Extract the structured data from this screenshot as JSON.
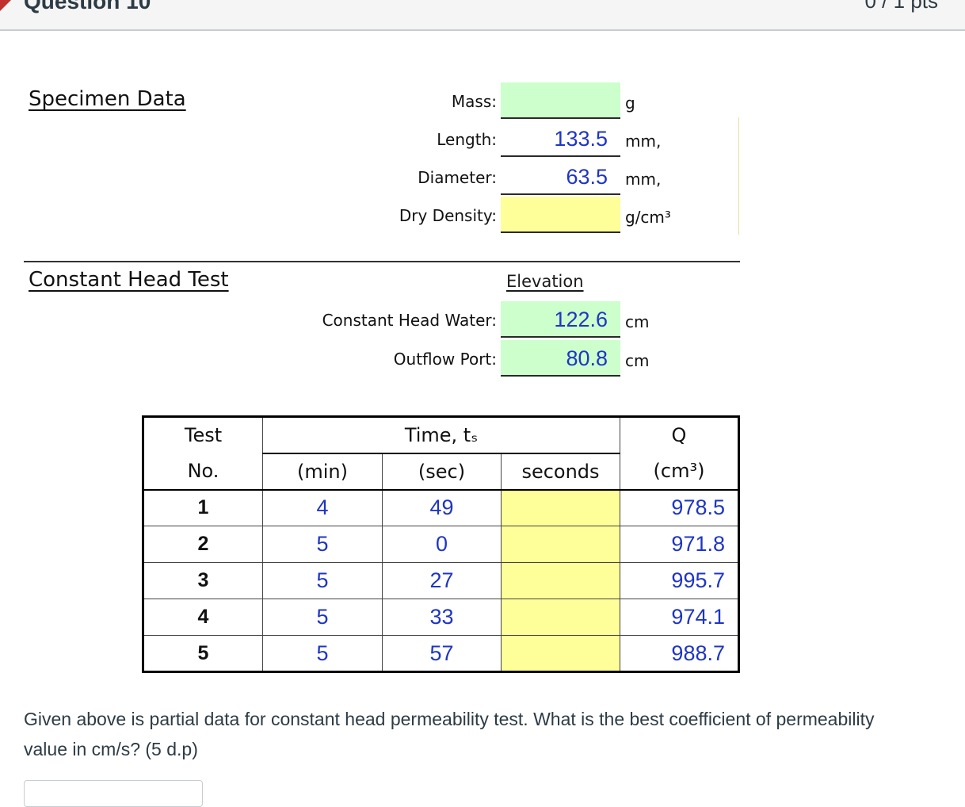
{
  "question": {
    "title": "Question 10",
    "points": "0 / 1 pts",
    "prompt": "Given above is partial data for constant head permeability test. What is the best coefficient of permeability value in cm/s? (5 d.p)",
    "answer_value": ""
  },
  "specimen": {
    "title": "Specimen Data",
    "rows": [
      {
        "label": "Mass:",
        "value": "",
        "unit": "g"
      },
      {
        "label": "Length:",
        "value": "133.5",
        "unit": "mm,"
      },
      {
        "label": "Diameter:",
        "value": "63.5",
        "unit": "mm,"
      },
      {
        "label": "Dry Density:",
        "value": "",
        "unit": "g/cm³"
      }
    ]
  },
  "constant_head": {
    "title": "Constant Head Test",
    "elevation_header": "Elevation",
    "rows": [
      {
        "label": "Constant Head Water:",
        "value": "122.6",
        "unit": "cm"
      },
      {
        "label": "Outflow Port:",
        "value": "80.8",
        "unit": "cm"
      }
    ]
  },
  "table": {
    "head1": {
      "test": "Test",
      "time": "Time, tₛ",
      "q": "Q"
    },
    "head2": {
      "no": "No.",
      "min": "(min)",
      "sec": "(sec)",
      "seconds": "seconds",
      "q_unit": "(cm³)"
    },
    "rows": [
      {
        "no": "1",
        "min": "4",
        "sec": "49",
        "seconds": "",
        "q": "978.5"
      },
      {
        "no": "2",
        "min": "5",
        "sec": "0",
        "seconds": "",
        "q": "971.8"
      },
      {
        "no": "3",
        "min": "5",
        "sec": "27",
        "seconds": "",
        "q": "995.7"
      },
      {
        "no": "4",
        "min": "5",
        "sec": "33",
        "seconds": "",
        "q": "974.1"
      },
      {
        "no": "5",
        "min": "5",
        "sec": "57",
        "seconds": "",
        "q": "988.7"
      }
    ]
  },
  "colors": {
    "input_green": "#ccffcc",
    "calc_yellow": "#ffff99",
    "value_blue": "#1f35c4"
  }
}
